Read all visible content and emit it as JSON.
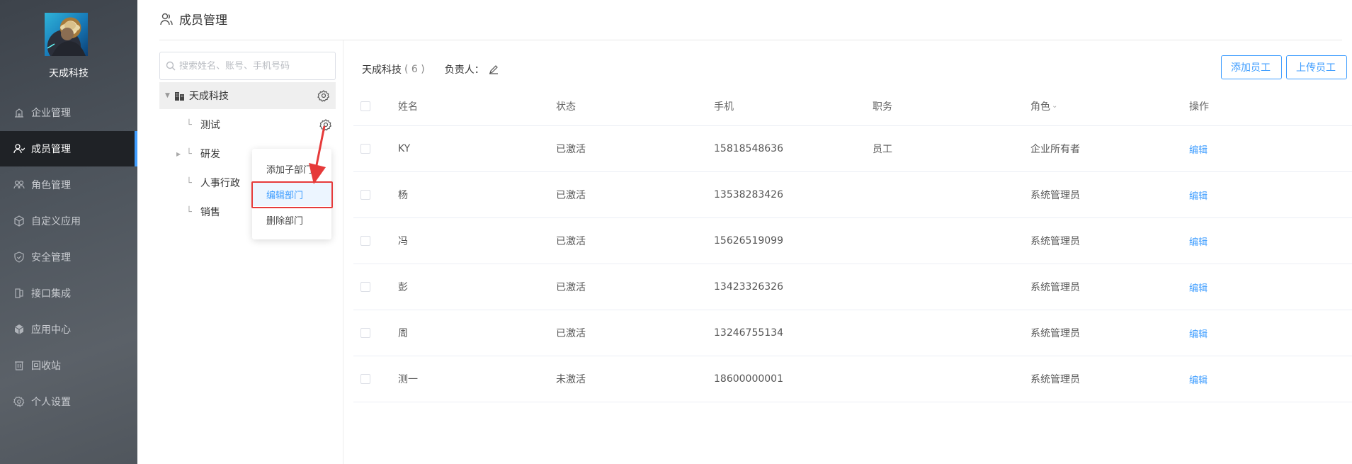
{
  "sidebar": {
    "company_name": "天成科技",
    "items": [
      {
        "label": "企业管理",
        "icon": "enterprise-icon"
      },
      {
        "label": "成员管理",
        "icon": "members-icon",
        "active": true
      },
      {
        "label": "角色管理",
        "icon": "roles-icon"
      },
      {
        "label": "自定义应用",
        "icon": "cube-icon"
      },
      {
        "label": "安全管理",
        "icon": "shield-icon"
      },
      {
        "label": "接口集成",
        "icon": "api-icon"
      },
      {
        "label": "应用中心",
        "icon": "app-center-icon"
      },
      {
        "label": "回收站",
        "icon": "trash-icon"
      },
      {
        "label": "个人设置",
        "icon": "gear-icon"
      }
    ]
  },
  "header": {
    "title": "成员管理"
  },
  "tree": {
    "search_placeholder": "搜索姓名、账号、手机号码",
    "root": "天成科技",
    "nodes": [
      "测试",
      "研发",
      "人事行政",
      "销售"
    ]
  },
  "context_menu": {
    "items": [
      "添加子部门",
      "编辑部门",
      "删除部门"
    ]
  },
  "main": {
    "dept_name": "天成科技",
    "dept_count": "( 6 )",
    "leader_label": "负责人：",
    "add_button": "添加员工",
    "upload_button": "上传员工"
  },
  "table": {
    "columns": [
      "姓名",
      "状态",
      "手机",
      "职务",
      "角色",
      "操作"
    ],
    "rows": [
      {
        "name": "KY",
        "status": "已激活",
        "phone": "15818548636",
        "position": "员工",
        "role": "企业所有者",
        "action": "编辑"
      },
      {
        "name": "杨",
        "status": "已激活",
        "phone": "13538283426",
        "position": "",
        "role": "系统管理员",
        "action": "编辑"
      },
      {
        "name": "冯",
        "status": "已激活",
        "phone": "15626519099",
        "position": "",
        "role": "系统管理员",
        "action": "编辑"
      },
      {
        "name": "彭",
        "status": "已激活",
        "phone": "13423326326",
        "position": "",
        "role": "系统管理员",
        "action": "编辑"
      },
      {
        "name": "周",
        "status": "已激活",
        "phone": "13246755134",
        "position": "",
        "role": "系统管理员",
        "action": "编辑"
      },
      {
        "name": "测一",
        "status": "未激活",
        "phone": "18600000001",
        "position": "",
        "role": "系统管理员",
        "action": "编辑"
      }
    ]
  },
  "colors": {
    "sidebar_bg": "#4a5058",
    "active_nav_bg": "#1f2226",
    "accent": "#409eff",
    "annotation_red": "#e63a3a"
  }
}
